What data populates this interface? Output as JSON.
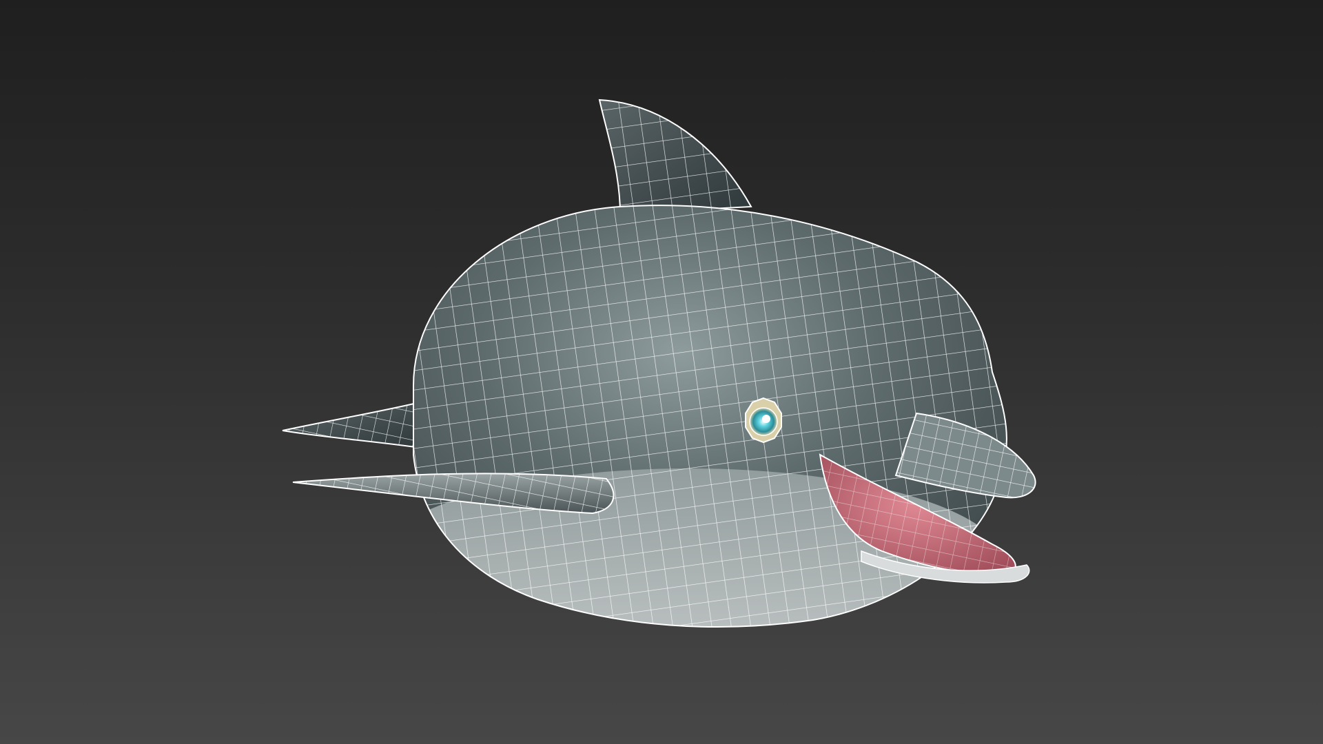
{
  "viewport": {
    "background_top": "#1f1f1f",
    "background_bottom": "#474747",
    "shading_mode": "smooth-shaded-with-wireframe"
  },
  "model": {
    "subject": "dolphin",
    "body_color": "#7f8d8e",
    "wire_color": "#ffffff",
    "mouth_color": "#c9707c",
    "eye_color": "#5fd3e0"
  }
}
